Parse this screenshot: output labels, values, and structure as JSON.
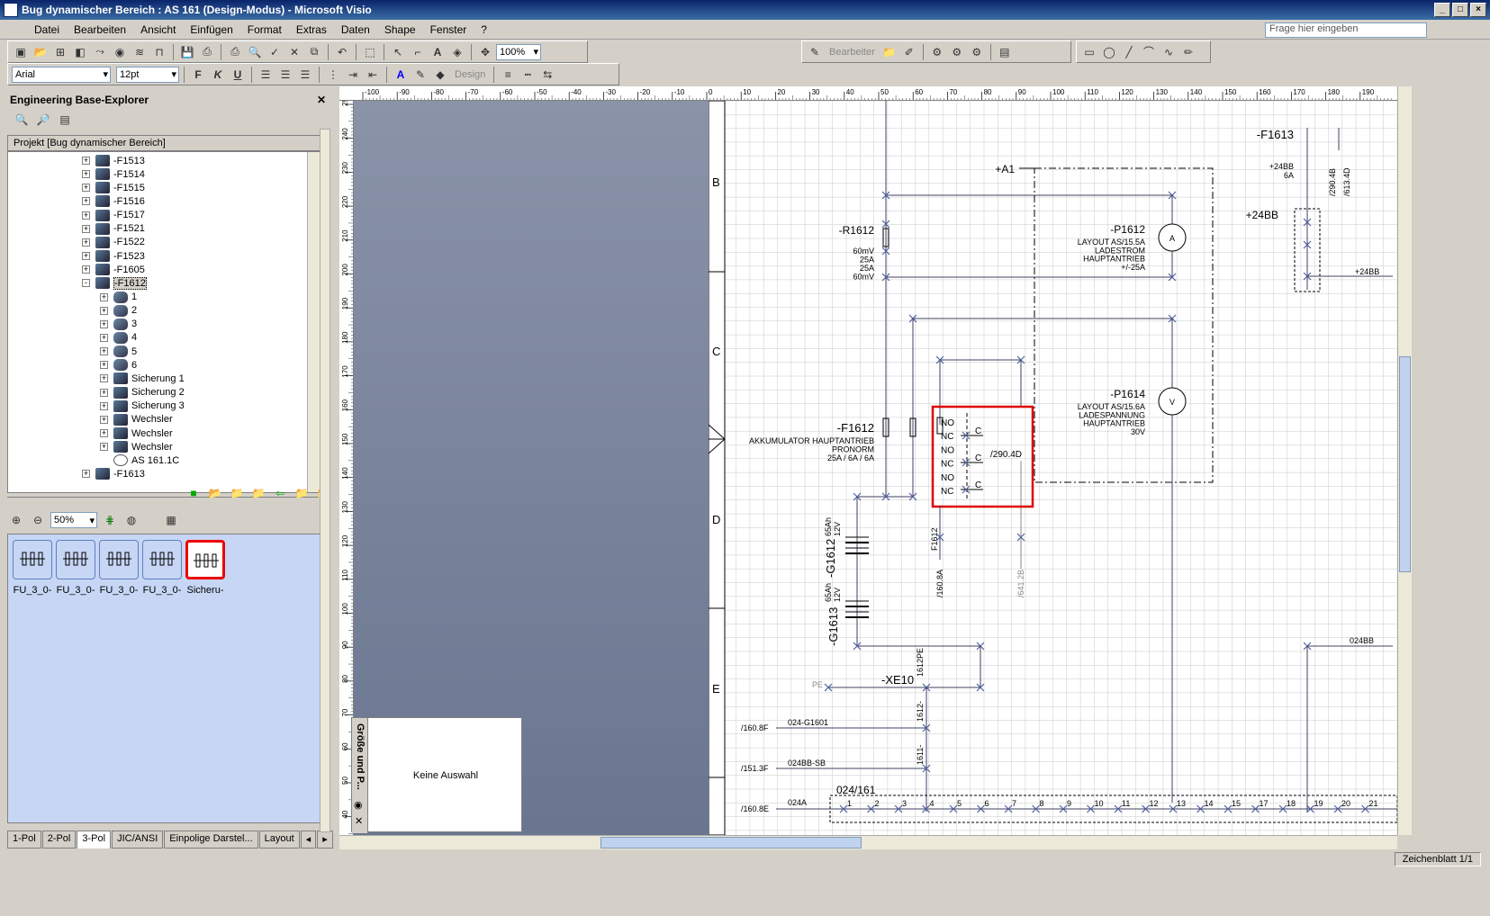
{
  "window": {
    "title": "Bug dynamischer Bereich : AS 161 (Design-Modus) - Microsoft Visio"
  },
  "menu": {
    "items": [
      "Datei",
      "Bearbeiten",
      "Ansicht",
      "Einfügen",
      "Format",
      "Extras",
      "Daten",
      "Shape",
      "Fenster",
      "?"
    ],
    "help_placeholder": "Frage hier eingeben"
  },
  "toolbar": {
    "zoom": "100%",
    "font": "Arial",
    "font_size": "12pt",
    "bold": "F",
    "italic": "K",
    "underline": "U",
    "design": "Design",
    "edit_label": "Bearbeiter"
  },
  "explorer": {
    "title": "Engineering Base-Explorer",
    "project": "Projekt [Bug dynamischer Bereich]",
    "tree": [
      {
        "label": "-F1513",
        "indent": 0,
        "exp": "+",
        "icon": "dev"
      },
      {
        "label": "-F1514",
        "indent": 0,
        "exp": "+",
        "icon": "dev"
      },
      {
        "label": "-F1515",
        "indent": 0,
        "exp": "+",
        "icon": "dev"
      },
      {
        "label": "-F1516",
        "indent": 0,
        "exp": "+",
        "icon": "dev"
      },
      {
        "label": "-F1517",
        "indent": 0,
        "exp": "+",
        "icon": "dev"
      },
      {
        "label": "-F1521",
        "indent": 0,
        "exp": "+",
        "icon": "dev"
      },
      {
        "label": "-F1522",
        "indent": 0,
        "exp": "+",
        "icon": "dev"
      },
      {
        "label": "-F1523",
        "indent": 0,
        "exp": "+",
        "icon": "dev"
      },
      {
        "label": "-F1605",
        "indent": 0,
        "exp": "+",
        "icon": "dev"
      },
      {
        "label": "-F1612",
        "indent": 0,
        "exp": "-",
        "icon": "dev",
        "selected": true
      },
      {
        "label": "1",
        "indent": 1,
        "exp": "+",
        "icon": "plug"
      },
      {
        "label": "2",
        "indent": 1,
        "exp": "+",
        "icon": "plug"
      },
      {
        "label": "3",
        "indent": 1,
        "exp": "+",
        "icon": "plug"
      },
      {
        "label": "4",
        "indent": 1,
        "exp": "+",
        "icon": "plug"
      },
      {
        "label": "5",
        "indent": 1,
        "exp": "+",
        "icon": "plug"
      },
      {
        "label": "6",
        "indent": 1,
        "exp": "+",
        "icon": "plug"
      },
      {
        "label": "Sicherung 1",
        "indent": 1,
        "exp": "+",
        "icon": "dev"
      },
      {
        "label": "Sicherung 2",
        "indent": 1,
        "exp": "+",
        "icon": "dev"
      },
      {
        "label": "Sicherung 3",
        "indent": 1,
        "exp": "+",
        "icon": "dev"
      },
      {
        "label": "Wechsler",
        "indent": 1,
        "exp": "+",
        "icon": "dev"
      },
      {
        "label": "Wechsler",
        "indent": 1,
        "exp": "+",
        "icon": "dev"
      },
      {
        "label": "Wechsler",
        "indent": 1,
        "exp": "+",
        "icon": "dev"
      },
      {
        "label": "AS 161.1C",
        "indent": 1,
        "exp": "",
        "icon": "obj"
      },
      {
        "label": "-F1613",
        "indent": 0,
        "exp": "+",
        "icon": "dev"
      }
    ],
    "zoom": "50%",
    "stencils": [
      "FU_3_0-",
      "FU_3_0-",
      "FU_3_0-",
      "FU_3_0-",
      "Sicheru-"
    ],
    "tabs": [
      "1-Pol",
      "2-Pol",
      "3-Pol",
      "JIC/ANSI",
      "Einpolige Darstel...",
      "Layout"
    ],
    "active_tab": "3-Pol"
  },
  "sizepos": {
    "title": "Größe und P...",
    "empty": "Keine Auswahl"
  },
  "ruler": {
    "h_ticks": [
      "-100",
      "-90",
      "-80",
      "-70",
      "-60",
      "-50",
      "-40",
      "-30",
      "-20",
      "-10",
      "0",
      "10",
      "20",
      "30",
      "40",
      "50",
      "60",
      "70",
      "80",
      "90",
      "100",
      "110",
      "120",
      "130",
      "140",
      "150",
      "160",
      "170",
      "180",
      "190"
    ],
    "v_ticks": [
      "250",
      "240",
      "230",
      "220",
      "210",
      "200",
      "190",
      "180",
      "170",
      "160",
      "150",
      "140",
      "130",
      "120",
      "110",
      "100",
      "90",
      "80",
      "70",
      "60",
      "50",
      "40"
    ]
  },
  "drawing": {
    "rows": [
      "B",
      "C",
      "D",
      "E"
    ],
    "labels": {
      "a1": "+A1",
      "r1612": "-R1612",
      "r_vals": [
        "60mV",
        "25A",
        "25A",
        "60mV"
      ],
      "p1612": "-P1612",
      "p1612_desc": [
        "LAYOUT AS/15.5A",
        "LADESTROM",
        "HAUPTANTRIEB",
        "+/-25A"
      ],
      "p1614": "-P1614",
      "p1614_desc": [
        "LAYOUT AS/15.6A",
        "LADESPANNUNG",
        "HAUPTANTRIEB",
        "30V"
      ],
      "f1612": "-F1612",
      "f1612_desc": [
        "AKKUMULATOR HAUPTANTRIEB",
        "PRONORM",
        "25A / 6A / 6A"
      ],
      "contacts": [
        "NO",
        "NC",
        "NO",
        "NC",
        "NO",
        "NC"
      ],
      "c": "C",
      "ref2904d": "/290.4D",
      "f1613": "-F1613",
      "f1613_vals": [
        "+24BB",
        "6A"
      ],
      "f1613_refs": [
        "/290.4B",
        "/613.4D"
      ],
      "bb24": "+24BB",
      "bb24_r": "+24BB",
      "g1612": "-G1612",
      "g1613": "-G1613",
      "g_vals": [
        "65Ah",
        "12V"
      ],
      "f1612_v": "F1612",
      "ref1608a": "/160.8A",
      "ref6412b": "/641.2B",
      "xe10": "-XE10",
      "pe": "PE",
      "w1612pe": "1612PE",
      "w1612": "1612-",
      "w1611": "1611-",
      "ref1608f": "/160.8F",
      "g1601": "024-G1601",
      "ref1513f": "/151.3F",
      "bbsb": "024BB-SB",
      "term": "024/161",
      "ref1608e": "/160.8E",
      "a024": "024A",
      "bb024": "024BB",
      "term_nums": [
        "1",
        "2",
        "3",
        "4",
        "5",
        "6",
        "7",
        "8",
        "9",
        "10",
        "11",
        "12",
        "13",
        "14",
        "15",
        "17",
        "18",
        "19",
        "20",
        "21"
      ]
    }
  },
  "status": {
    "sheet": "Zeichenblatt 1/1"
  },
  "colors": {
    "accent": "#e00000",
    "line": "#404060",
    "wire": "#5a5a9a"
  }
}
